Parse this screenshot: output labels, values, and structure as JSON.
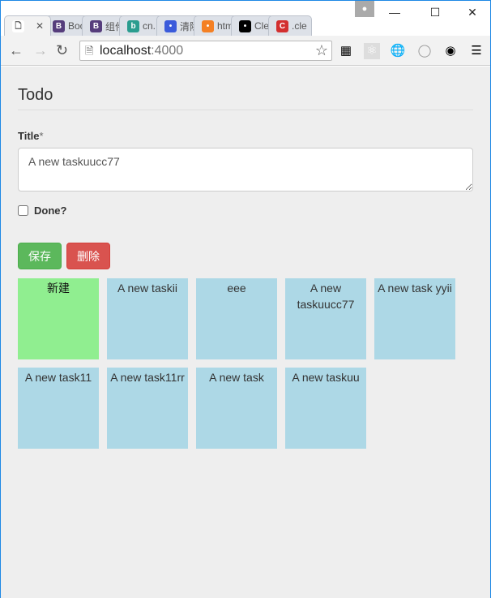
{
  "browser": {
    "tabs": [
      {
        "label": "",
        "icon": "page-icon",
        "active": true,
        "color": "#ffffff"
      },
      {
        "label": "Boo",
        "icon": "B",
        "color": "#563d7c"
      },
      {
        "label": "组件",
        "icon": "B",
        "color": "#563d7c"
      },
      {
        "label": "cn.",
        "icon": "b",
        "color": "#2a9d8f"
      },
      {
        "label": "清除",
        "icon": "paw",
        "color": "#3b5bdb"
      },
      {
        "label": "htm",
        "icon": "stack",
        "color": "#f48024"
      },
      {
        "label": "Cle",
        "icon": "bug",
        "color": "#000000"
      },
      {
        "label": ".cle",
        "icon": "C",
        "color": "#d32f2f"
      }
    ],
    "address_host": "localhost",
    "address_port": ":4000"
  },
  "page": {
    "heading": "Todo",
    "title_label": "Title",
    "required_mark": "*",
    "title_value": "A new taskuucc77",
    "done_label": "Done?",
    "done_checked": false,
    "save_label": "保存",
    "delete_label": "删除",
    "cards": [
      {
        "label": "新建",
        "new": true
      },
      {
        "label": "A new taskii"
      },
      {
        "label": "eee"
      },
      {
        "label": "A new taskuucc77"
      },
      {
        "label": "A new task yyii"
      },
      {
        "label": "A new task11"
      },
      {
        "label": "A new task11rr"
      },
      {
        "label": "A new task"
      },
      {
        "label": "A new taskuu"
      }
    ]
  },
  "colors": {
    "new_card": "#90ee90",
    "card": "#add8e6",
    "save": "#5cb85c",
    "delete": "#d9534f"
  }
}
